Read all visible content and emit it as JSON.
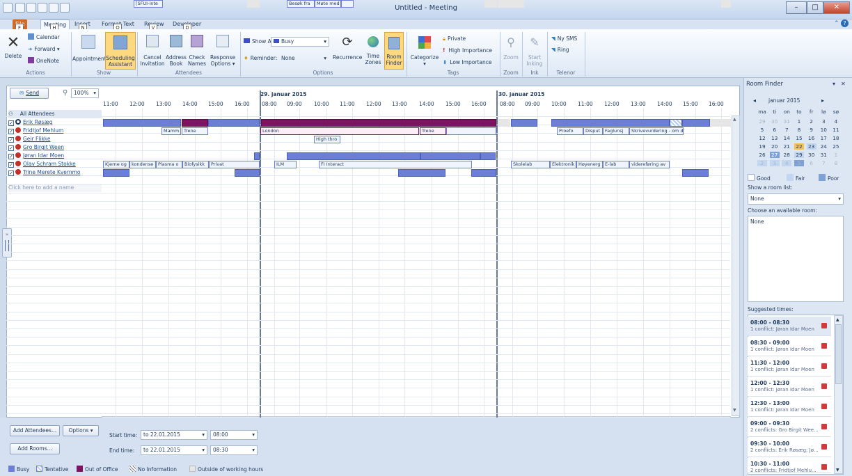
{
  "window": {
    "title": "Untitled - Meeting"
  },
  "tabs": [
    "File",
    "Meeting",
    "Insert",
    "Format Text",
    "Review",
    "Developer"
  ],
  "keytips": [
    "F",
    "H",
    "N",
    "O",
    "V",
    "D"
  ],
  "ribbon": {
    "actions": {
      "delete": "Delete",
      "calendar": "Calendar",
      "forward": "Forward",
      "onenote": "OneNote",
      "label": "Actions"
    },
    "show": {
      "appointment": "Appointment",
      "scheduling_1": "Scheduling",
      "scheduling_2": "Assistant",
      "label": "Show"
    },
    "attendees": {
      "cancel_1": "Cancel",
      "cancel_2": "Invitation",
      "address_1": "Address",
      "address_2": "Book",
      "check_1": "Check",
      "check_2": "Names",
      "response_1": "Response",
      "response_2": "Options",
      "label": "Attendees"
    },
    "options": {
      "show_as_label": "Show As:",
      "show_as_value": "Busy",
      "reminder_label": "Reminder:",
      "reminder_value": "None",
      "recurrence": "Recurrence",
      "time_1": "Time",
      "time_2": "Zones",
      "room_1": "Room",
      "room_2": "Finder",
      "label": "Options"
    },
    "tags": {
      "categorize": "Categorize",
      "private": "Private",
      "high": "High Importance",
      "low": "Low Importance",
      "label": "Tags"
    },
    "zoom": {
      "zoom": "Zoom",
      "label": "Zoom"
    },
    "ink": {
      "start_1": "Start",
      "start_2": "Inking",
      "label": "Ink"
    },
    "telenor": {
      "ny_sms": "Ny SMS",
      "ring": "Ring",
      "label": "Telenor"
    }
  },
  "toolbar": {
    "send": "Send",
    "zoom": "100%"
  },
  "days": [
    "29. januar 2015",
    "30. januar 2015"
  ],
  "times": [
    "11:00",
    "12:00",
    "13:00",
    "14:00",
    "15:00",
    "16:00",
    "08:00",
    "09:00",
    "10:00",
    "11:00",
    "12:00",
    "13:00",
    "14:00",
    "15:00",
    "16:00",
    "08:00",
    "09:00",
    "10:00",
    "11:00",
    "12:00",
    "13:00",
    "14:00",
    "15:00",
    "16:00"
  ],
  "attendees": {
    "all": "All Attendees",
    "people": [
      "Erik Røsæg",
      "Fridtjof Mehlum",
      "Geir Flikke",
      "Gro Birgit Ween",
      "Jøran Idar Moen",
      "Olav Schram Stokke",
      "Trine Merete Kvernmo"
    ],
    "add_placeholder": "Click here to add a name"
  },
  "appointments": {
    "erik": [
      "Mamm",
      "Trene",
      "London",
      "Trene",
      "Proefo",
      "Disput",
      "Faglunsj",
      "Skrivevurdering - om de"
    ],
    "fridtjof": [
      "High thro"
    ],
    "joran": [
      "Kjerne og",
      "kondense",
      "Plasma o",
      "Biofysikk",
      "Privat",
      "ILM",
      "FI Interact",
      "Skolelab",
      "Elektronik",
      "Høyenerg",
      "E-lab",
      "videreføring av"
    ],
    "trine": [
      "[SFUI-inte",
      "Besøk fra",
      "Møte med"
    ]
  },
  "bottom": {
    "add_attendees": "Add Attendees...",
    "options": "Options",
    "add_rooms": "Add Rooms...",
    "start_label": "Start time:",
    "start_date": "to 22.01.2015",
    "start_time": "08:00",
    "end_label": "End time:",
    "end_date": "to 22.01.2015",
    "end_time": "08:30"
  },
  "legend": [
    "Busy",
    "Tentative",
    "Out of Office",
    "No Information",
    "Outside of working hours"
  ],
  "room_finder": {
    "title": "Room Finder",
    "month": "januar 2015",
    "weekdays": [
      "ma",
      "ti",
      "on",
      "to",
      "fr",
      "lø",
      "sø"
    ],
    "weeks": [
      [
        "29",
        "30",
        "31",
        "1",
        "2",
        "3",
        "4"
      ],
      [
        "5",
        "6",
        "7",
        "8",
        "9",
        "10",
        "11"
      ],
      [
        "12",
        "13",
        "14",
        "15",
        "16",
        "17",
        "18"
      ],
      [
        "19",
        "20",
        "21",
        "22",
        "23",
        "24",
        "25"
      ],
      [
        "26",
        "27",
        "28",
        "29",
        "30",
        "31",
        "1"
      ],
      [
        "2",
        "3",
        "4",
        "5",
        "6",
        "7",
        "8"
      ]
    ],
    "quality": [
      "Good",
      "Fair",
      "Poor"
    ],
    "show_room_list": "Show a room list:",
    "room_list_value": "None",
    "choose_room": "Choose an available room:",
    "room_value": "None",
    "suggested": "Suggested times:",
    "suggestions": [
      {
        "time": "08:00 - 08:30",
        "conflict": "1 conflict: Jøran Idar Moen"
      },
      {
        "time": "08:30 - 09:00",
        "conflict": "1 conflict: Jøran Idar Moen"
      },
      {
        "time": "11:30 - 12:00",
        "conflict": "1 conflict: Jøran Idar Moen"
      },
      {
        "time": "12:00 - 12:30",
        "conflict": "1 conflict: Jøran Idar Moen"
      },
      {
        "time": "12:30 - 13:00",
        "conflict": "1 conflict: Jøran Idar Moen"
      },
      {
        "time": "09:00 - 09:30",
        "conflict": "2 conflicts: Gro Birgit Wee..."
      },
      {
        "time": "09:30 - 10:00",
        "conflict": "2 conflicts: Erik Røsæg; Jø..."
      },
      {
        "time": "10:30 - 11:00",
        "conflict": "2 conflicts: Fridtjof Mehlu..."
      }
    ]
  },
  "colors": {
    "busy": "#6c7ed8",
    "ooo": "#7d1462",
    "tentative": "#b8c8ee",
    "file_tab": "#d26b26"
  }
}
